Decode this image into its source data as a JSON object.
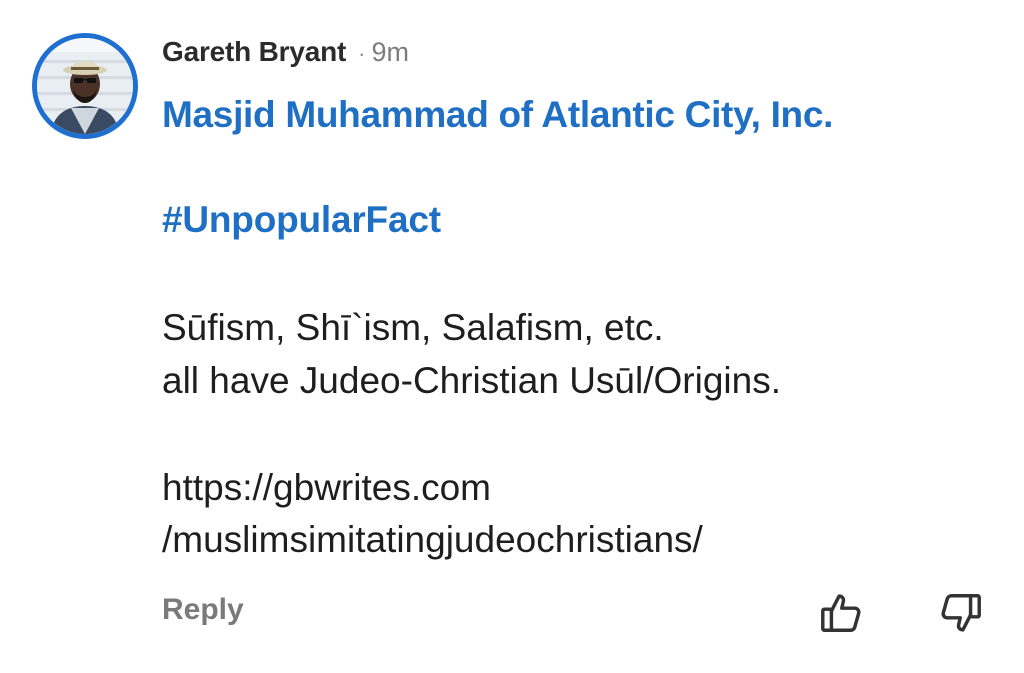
{
  "comment": {
    "author": "Gareth Bryant",
    "separator": "·",
    "time": "9m",
    "org_link": "Masjid Muhammad of Atlantic City, Inc.",
    "hashtag": "#UnpopularFact",
    "body_lines": [
      "Sūfism, Shī`ism, Salafism, etc.",
      "all have Judeo-Christian Usūl/Origins.",
      "https://gbwrites.com",
      "/muslimsimitatingjudeochristians/"
    ]
  },
  "actions": {
    "reply_label": "Reply",
    "like_icon": "thumbs-up-icon",
    "dislike_icon": "thumbs-down-icon"
  },
  "colors": {
    "link": "#1f6fc4",
    "avatar_ring": "#1f6fd1",
    "muted": "#7a7a7a"
  }
}
